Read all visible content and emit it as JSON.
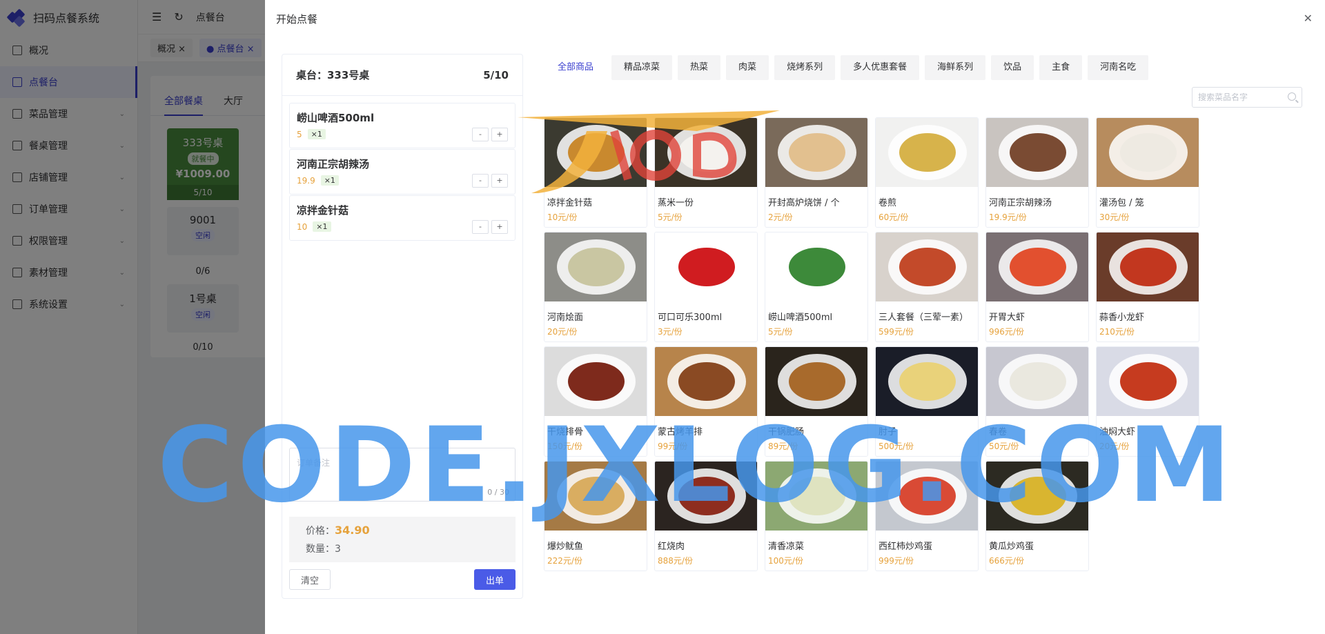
{
  "app": {
    "title": "扫码点餐系统"
  },
  "sidebar": {
    "items": [
      {
        "label": "概况",
        "icon": "dashboard-icon",
        "active": false,
        "expandable": false
      },
      {
        "label": "点餐台",
        "icon": "monitor-icon",
        "active": true,
        "expandable": false
      },
      {
        "label": "菜品管理",
        "icon": "dish-icon",
        "active": false,
        "expandable": true
      },
      {
        "label": "餐桌管理",
        "icon": "table-icon",
        "active": false,
        "expandable": true
      },
      {
        "label": "店铺管理",
        "icon": "store-icon",
        "active": false,
        "expandable": true
      },
      {
        "label": "订单管理",
        "icon": "order-icon",
        "active": false,
        "expandable": true
      },
      {
        "label": "权限管理",
        "icon": "lock-icon",
        "active": false,
        "expandable": true
      },
      {
        "label": "素材管理",
        "icon": "image-icon",
        "active": false,
        "expandable": true
      },
      {
        "label": "系统设置",
        "icon": "gear-icon",
        "active": false,
        "expandable": true
      }
    ]
  },
  "topbar": {
    "breadcrumb": "点餐台"
  },
  "page_tabs": [
    {
      "label": "概况",
      "active": false
    },
    {
      "label": "点餐台",
      "active": true
    }
  ],
  "background": {
    "tabs": [
      "全部餐桌",
      "大厅"
    ],
    "tables": [
      {
        "name": "333号桌",
        "status": "就餐中",
        "price": "¥1009.00",
        "seats": "5/10",
        "busy": true
      },
      {
        "name": "9001",
        "status": "空闲",
        "seats": "0/6",
        "busy": false
      },
      {
        "name": "1号桌",
        "status": "空闲",
        "seats": "0/10",
        "busy": false
      }
    ]
  },
  "drawer": {
    "title": "开始点餐",
    "order": {
      "table_label": "桌台：333号桌",
      "occupancy": "5/10",
      "items": [
        {
          "name": "崂山啤酒500ml",
          "price": "5",
          "qty": "×1"
        },
        {
          "name": "河南正宗胡辣汤",
          "price": "19.9",
          "qty": "×1"
        },
        {
          "name": "凉拌金针菇",
          "price": "10",
          "qty": "×1"
        }
      ],
      "remark_placeholder": "订单备注",
      "remark_counter": "0 / 30",
      "price_label": "价格：",
      "price_value": "34.90",
      "count_label": "数量：",
      "count_value": "3",
      "clear_label": "清空",
      "submit_label": "出单"
    },
    "categories": [
      {
        "label": "全部商品",
        "active": true
      },
      {
        "label": "精品凉菜",
        "active": false
      },
      {
        "label": "热菜",
        "active": false
      },
      {
        "label": "肉菜",
        "active": false
      },
      {
        "label": "烧烤系列",
        "active": false
      },
      {
        "label": "多人优惠套餐",
        "active": false
      },
      {
        "label": "海鲜系列",
        "active": false
      },
      {
        "label": "饮品",
        "active": false
      },
      {
        "label": "主食",
        "active": false
      },
      {
        "label": "河南名吃",
        "active": false
      }
    ],
    "search_placeholder": "搜索菜品名字",
    "dishes": [
      {
        "name": "凉拌金针菇",
        "price": "10元/份",
        "bg": "#3b3a30",
        "food": "#c9892e"
      },
      {
        "name": "蒸米一份",
        "price": "5元/份",
        "bg": "#3a3226",
        "food": "#f4f2ee"
      },
      {
        "name": "开封高炉烧饼 / 个",
        "price": "2元/份",
        "bg": "#7a6a5a",
        "food": "#e2c08f"
      },
      {
        "name": "卷煎",
        "price": "60元/份",
        "bg": "#f1f1f0",
        "food": "#d7b34b"
      },
      {
        "name": "河南正宗胡辣汤",
        "price": "19.9元/份",
        "bg": "#c9c4c0",
        "food": "#7a4b33"
      },
      {
        "name": "灌汤包 / 笼",
        "price": "30元/份",
        "bg": "#b78c5e",
        "food": "#eeeae2"
      },
      {
        "name": "河南烩面",
        "price": "20元/份",
        "bg": "#8d8d88",
        "food": "#c9c6a2"
      },
      {
        "name": "可口可乐300ml",
        "price": "3元/份",
        "bg": "#ffffff",
        "food": "#d01c20"
      },
      {
        "name": "崂山啤酒500ml",
        "price": "5元/份",
        "bg": "#ffffff",
        "food": "#3d8a3a"
      },
      {
        "name": "三人套餐（三荤一素）",
        "price": "599元/份",
        "bg": "#d8d2cc",
        "food": "#c34a2a"
      },
      {
        "name": "开胃大虾",
        "price": "996元/份",
        "bg": "#7a6f72",
        "food": "#e2502f"
      },
      {
        "name": "蒜香小龙虾",
        "price": "210元/份",
        "bg": "#6a3c2a",
        "food": "#c2371f"
      },
      {
        "name": "干烧排骨",
        "price": "150元/份",
        "bg": "#dcdcdc",
        "food": "#7e2a1c"
      },
      {
        "name": "蒙古烤羊排",
        "price": "99元/份",
        "bg": "#b7844b",
        "food": "#8a4a23"
      },
      {
        "name": "干锅肥肠",
        "price": "89元/份",
        "bg": "#2a241c",
        "food": "#a86a2c"
      },
      {
        "name": "肘子",
        "price": "500元/份",
        "bg": "#1a1d28",
        "food": "#e9d27a"
      },
      {
        "name": "春卷",
        "price": "50元/份",
        "bg": "#c7c7d0",
        "food": "#eae8df"
      },
      {
        "name": "油焖大虾",
        "price": "20元/份",
        "bg": "#d9dbe6",
        "food": "#c63b1f"
      },
      {
        "name": "爆炒鱿鱼",
        "price": "222元/份",
        "bg": "#a57a45",
        "food": "#d9ad61"
      },
      {
        "name": "红烧肉",
        "price": "888元/份",
        "bg": "#2b2420",
        "food": "#8e2d1f"
      },
      {
        "name": "清香凉菜",
        "price": "100元/份",
        "bg": "#8ca872",
        "food": "#dfe3c0"
      },
      {
        "name": "西红柿炒鸡蛋",
        "price": "999元/份",
        "bg": "#c4c8cf",
        "food": "#d94a35"
      },
      {
        "name": "黄瓜炒鸡蛋",
        "price": "666元/份",
        "bg": "#2c2a22",
        "food": "#d9b530"
      }
    ]
  },
  "watermark": {
    "text": "CODE.JXLOG.COM",
    "logo_text": "Jxlog"
  }
}
